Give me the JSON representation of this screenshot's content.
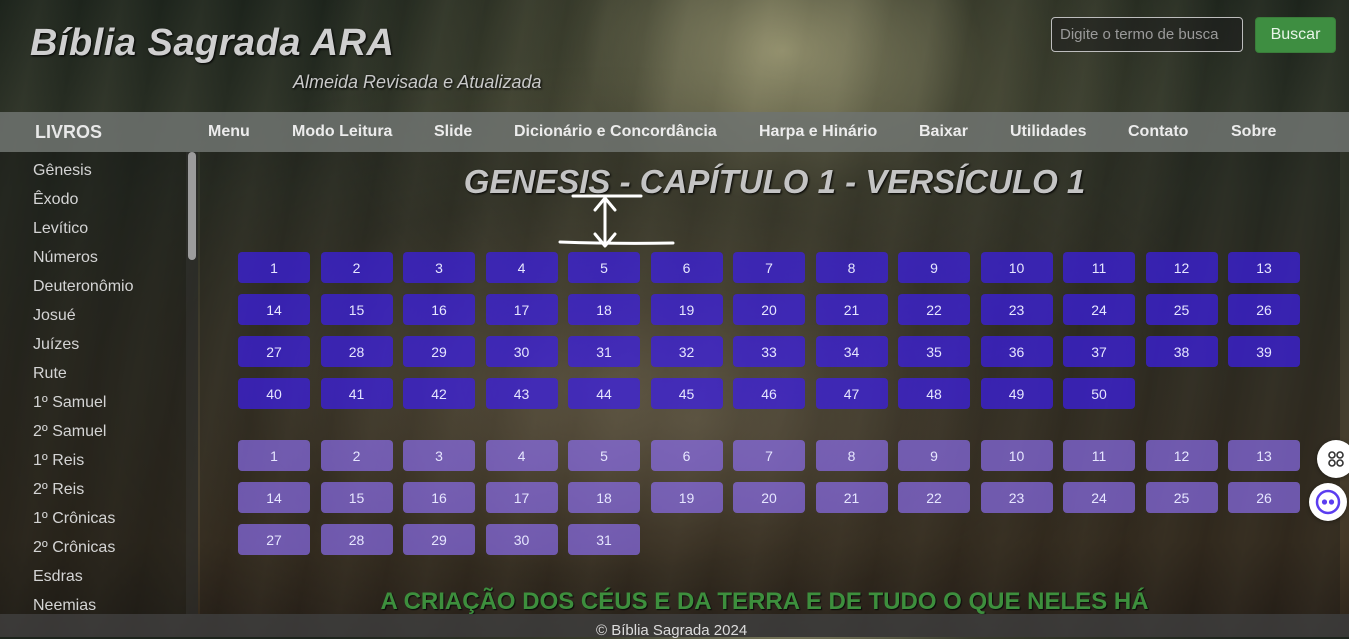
{
  "site": {
    "title": "Bíblia Sagrada ARA",
    "subtitle": "Almeida Revisada e Atualizada"
  },
  "search": {
    "placeholder": "Digite o termo de busca",
    "button_label": "Buscar"
  },
  "nav": {
    "books_label": "LIVROS",
    "items": [
      "Menu",
      "Modo Leitura",
      "Slide",
      "Dicionário e Concordância",
      "Harpa e Hinário",
      "Baixar",
      "Utilidades",
      "Contato",
      "Sobre"
    ]
  },
  "sidebar": {
    "books": [
      "Gênesis",
      "Êxodo",
      "Levítico",
      "Números",
      "Deuteronômio",
      "Josué",
      "Juízes",
      "Rute",
      "1º Samuel",
      "2º Samuel",
      "1º Reis",
      "2º Reis",
      "1º Crônicas",
      "2º Crônicas",
      "Esdras",
      "Neemias"
    ]
  },
  "main": {
    "heading": "GENESIS - CAPÍTULO 1 - VERSÍCULO 1",
    "chapters": [
      "1",
      "2",
      "3",
      "4",
      "5",
      "6",
      "7",
      "8",
      "9",
      "10",
      "11",
      "12",
      "13",
      "14",
      "15",
      "16",
      "17",
      "18",
      "19",
      "20",
      "21",
      "22",
      "23",
      "24",
      "25",
      "26",
      "27",
      "28",
      "29",
      "30",
      "31",
      "32",
      "33",
      "34",
      "35",
      "36",
      "37",
      "38",
      "39",
      "40",
      "41",
      "42",
      "43",
      "44",
      "45",
      "46",
      "47",
      "48",
      "49",
      "50"
    ],
    "verses": [
      "1",
      "2",
      "3",
      "4",
      "5",
      "6",
      "7",
      "8",
      "9",
      "10",
      "11",
      "12",
      "13",
      "14",
      "15",
      "16",
      "17",
      "18",
      "19",
      "20",
      "21",
      "22",
      "23",
      "24",
      "25",
      "26",
      "27",
      "28",
      "29",
      "30",
      "31"
    ],
    "verse_title": "A CRIAÇÃO DOS CÉUS E DA TERRA E DE TUDO O QUE NELES HÁ"
  },
  "footer": {
    "text": "© Bíblia Sagrada 2024"
  },
  "colors": {
    "chapter_button": "#3c1ee6",
    "verse_button": "#8c6ef0",
    "search_button": "#3e8e41",
    "verse_title": "#3d8f3d"
  },
  "icons": {
    "floating_top": "apps-grid-icon",
    "floating_bottom": "assistant-eyes-icon"
  }
}
